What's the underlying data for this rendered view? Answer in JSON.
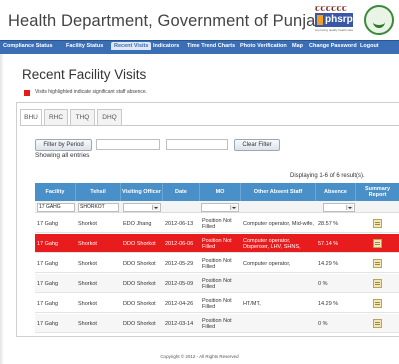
{
  "header": {
    "site_title": "Health Department, Government of Punjab",
    "logo_dots": "ꞇꞇꞇꞇꞇꞇ",
    "logo_text": "phsrp",
    "logo_tagline": "improving quality health care"
  },
  "nav": {
    "items": [
      {
        "label": "Compliance Status"
      },
      {
        "label": "Facility Status"
      },
      {
        "label": "Recent Visits"
      },
      {
        "label": "Indicators"
      },
      {
        "label": "Time Trend Charts"
      },
      {
        "label": "Photo Verification"
      },
      {
        "label": "Map"
      },
      {
        "label": "Change Password"
      },
      {
        "label": "Logout"
      }
    ],
    "active_index": 2
  },
  "main": {
    "title": "Recent Facility Visits",
    "legend_text": "Visits highlighted indicate significant staff absence.",
    "legend_color": "#e31b1b",
    "tabs": [
      {
        "label": "BHU"
      },
      {
        "label": "RHC"
      },
      {
        "label": "THQ"
      },
      {
        "label": "DHQ"
      }
    ],
    "filter_by_period_label": "Filter by Period",
    "clear_filter_label": "Clear Filter",
    "showing_text": "Showing all entries",
    "displaying_text": "Displaying 1-6 of 6 result(s)."
  },
  "table": {
    "headers": [
      "Facility",
      "Tehsil",
      "Visiting Officer",
      "Date",
      "MO",
      "Other Absent Staff",
      "Absence",
      "Summary Report"
    ],
    "filters": {
      "facility": "17 GAHG",
      "tehsil": "SHORKOT"
    },
    "rows": [
      {
        "facility": "17 Gahg",
        "tehsil": "Shorkot",
        "officer": "EDO Jhang",
        "date": "2012-06-13",
        "mo": "Position Not Filled",
        "other": "Computer operator, Mid-wife,",
        "absence": "28.57 %",
        "alert": false
      },
      {
        "facility": "17 Gahg",
        "tehsil": "Shorkot",
        "officer": "DDO Shorkot",
        "date": "2012-06-06",
        "mo": "Position Not Filled",
        "other": "Computer operator, Dispenser, LHV, SHNS,",
        "absence": "57.14 %",
        "alert": true
      },
      {
        "facility": "17 Gahg",
        "tehsil": "Shorkot",
        "officer": "DDO Shorkot",
        "date": "2012-05-29",
        "mo": "Position Not Filled",
        "other": "Computer operator,",
        "absence": "14.29 %",
        "alert": false
      },
      {
        "facility": "17 Gahg",
        "tehsil": "Shorkot",
        "officer": "DDO Shorkot",
        "date": "2012-05-09",
        "mo": "Position Not Filled",
        "other": "",
        "absence": "0 %",
        "alert": false
      },
      {
        "facility": "17 Gahg",
        "tehsil": "Shorkot",
        "officer": "DDO Shorkot",
        "date": "2012-04-26",
        "mo": "Position Not Filled",
        "other": "HT/MT,",
        "absence": "14.29 %",
        "alert": false
      },
      {
        "facility": "17 Gahg",
        "tehsil": "Shorkot",
        "officer": "DDO Shorkot",
        "date": "2012-03-14",
        "mo": "Position Not Filled",
        "other": "",
        "absence": "0 %",
        "alert": false
      }
    ]
  },
  "footer": {
    "text": "Copyright © 2012 - All Rights Reserved"
  }
}
